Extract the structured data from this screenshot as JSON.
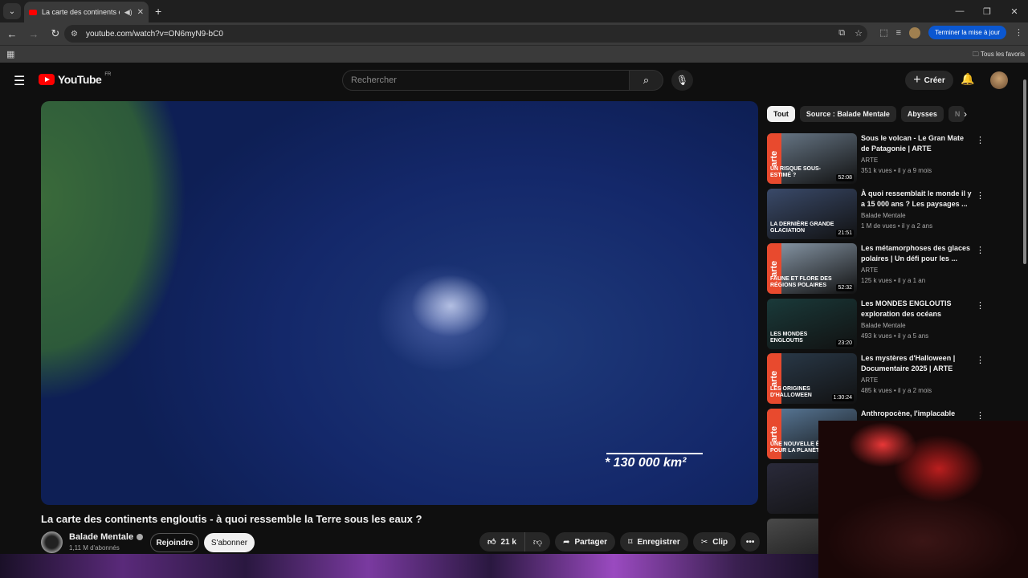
{
  "browser": {
    "tab_title": "La carte des continents eng",
    "url": "youtube.com/watch?v=ON6myN9-bC0",
    "update_button": "Terminer la mise à jour",
    "bookmarks_label": "Tous les favoris"
  },
  "youtube": {
    "logo_text": "YouTube",
    "region": "FR",
    "search_placeholder": "Rechercher",
    "create_label": "Créer"
  },
  "video": {
    "overlay_text": "* 130 000 km²",
    "title": "La carte des continents engloutis - à quoi ressemble la Terre sous les eaux ?",
    "channel": "Balade Mentale",
    "subscribers": "1,11 M d'abonnés",
    "join_label": "Rejoindre",
    "subscribe_label": "S'abonner",
    "likes": "21 k",
    "share_label": "Partager",
    "save_label": "Enregistrer",
    "clip_label": "Clip"
  },
  "chips": [
    "Tout",
    "Source : Balade Mentale",
    "Abysses",
    "N"
  ],
  "recommendations": [
    {
      "title": "Sous le volcan - Le Gran Mate de Patagonie | ARTE",
      "channel": "ARTE",
      "stats": "351 k vues • il y a 9 mois",
      "duration": "52:08",
      "overlay": "UN RISQUE SOUS-ESTIMÉ ?",
      "arte": "arte",
      "color": "#6a7a8a"
    },
    {
      "title": "À quoi ressemblait le monde il y a 15 000 ans ? Les paysages ...",
      "channel": "Balade Mentale",
      "stats": "1 M de vues • il y a 2 ans",
      "duration": "21:51",
      "overlay": "LA DERNIÈRE GRANDE GLACIATION",
      "arte": "",
      "color": "#3a4a6a"
    },
    {
      "title": "Les métamorphoses des glaces polaires | Un défi pour les ...",
      "channel": "ARTE",
      "stats": "125 k vues • il y a 1 an",
      "duration": "52:32",
      "overlay": "FAUNE ET FLORE DES RÉGIONS POLAIRES",
      "arte": "arte",
      "color": "#8a9aaa"
    },
    {
      "title": "Les MONDES ENGLOUTIS exploration des océans",
      "channel": "Balade Mentale",
      "stats": "493 k vues • il y a 5 ans",
      "duration": "23:20",
      "overlay": "LES MONDES ENGLOUTIS",
      "arte": "",
      "color": "#1a3a3a"
    },
    {
      "title": "Les mystères d'Halloween | Documentaire 2025 | ARTE",
      "channel": "ARTE",
      "stats": "485 k vues • il y a 2 mois",
      "duration": "1:30:24",
      "overlay": "LES ORIGINES D'HALLOWEEN",
      "arte": "arte",
      "color": "#2a3a4a"
    },
    {
      "title": "Anthropocène, l'implacable",
      "channel": "",
      "stats": "",
      "duration": "",
      "overlay": "UNE NOUVELLE ÈRE POUR LA PLANÈTE",
      "arte": "arte",
      "color": "#5a7a9a"
    },
    {
      "title": "",
      "channel": "",
      "stats": "",
      "duration": "",
      "overlay": "",
      "arte": "",
      "color": "#2a2a3a"
    },
    {
      "title": "",
      "channel": "",
      "stats": "",
      "duration": "",
      "overlay": "",
      "arte": "",
      "color": "#4a4a4a"
    }
  ]
}
